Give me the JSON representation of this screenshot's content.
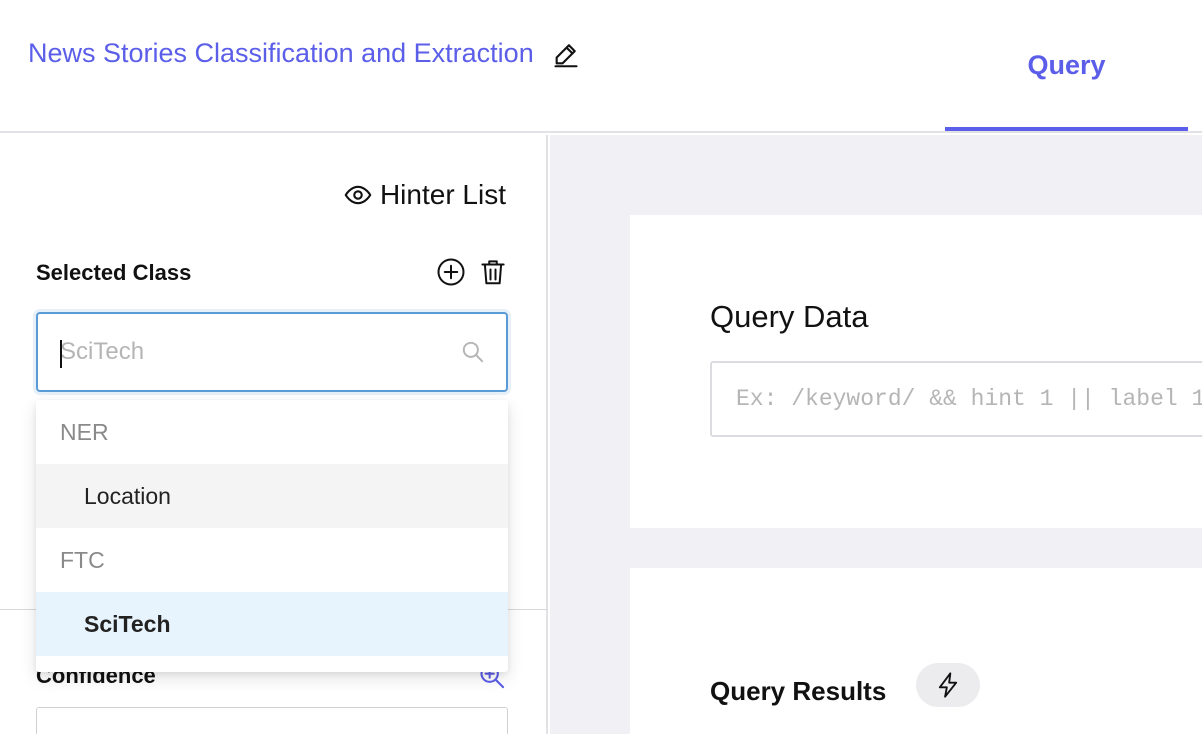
{
  "header": {
    "project_title": "News Stories Classification and Extraction",
    "edit_icon": "pencil-icon",
    "tabs": [
      {
        "label": "Query",
        "active": true
      }
    ]
  },
  "left_panel": {
    "hinter_list_label": "Hinter List",
    "hinter_list_icon": "eye-icon",
    "selected_class_label": "Selected Class",
    "add_icon": "plus-circle-icon",
    "delete_icon": "trash-icon",
    "search": {
      "value": "",
      "placeholder": "SciTech",
      "icon": "search-icon"
    },
    "dropdown": {
      "groups": [
        {
          "label": "NER",
          "options": [
            {
              "label": "Location",
              "state": "hover"
            }
          ]
        },
        {
          "label": "FTC",
          "options": [
            {
              "label": "SciTech",
              "state": "selected"
            }
          ]
        }
      ]
    },
    "confidence_label": "Confidence",
    "confidence_icon": "zoom-in-icon"
  },
  "main": {
    "query_data_label": "Query Data",
    "query_input": {
      "value": "",
      "placeholder": "Ex: /keyword/ && hint 1 || label 1"
    },
    "query_results_label": "Query Results",
    "run_icon": "lightning-icon"
  },
  "colors": {
    "accent": "#5b5ee8",
    "focus_border": "#5b9bd5",
    "selected_bg": "#e8f4fd",
    "hover_bg": "#f4f4f4",
    "canvas_bg": "#f1f1f5"
  }
}
